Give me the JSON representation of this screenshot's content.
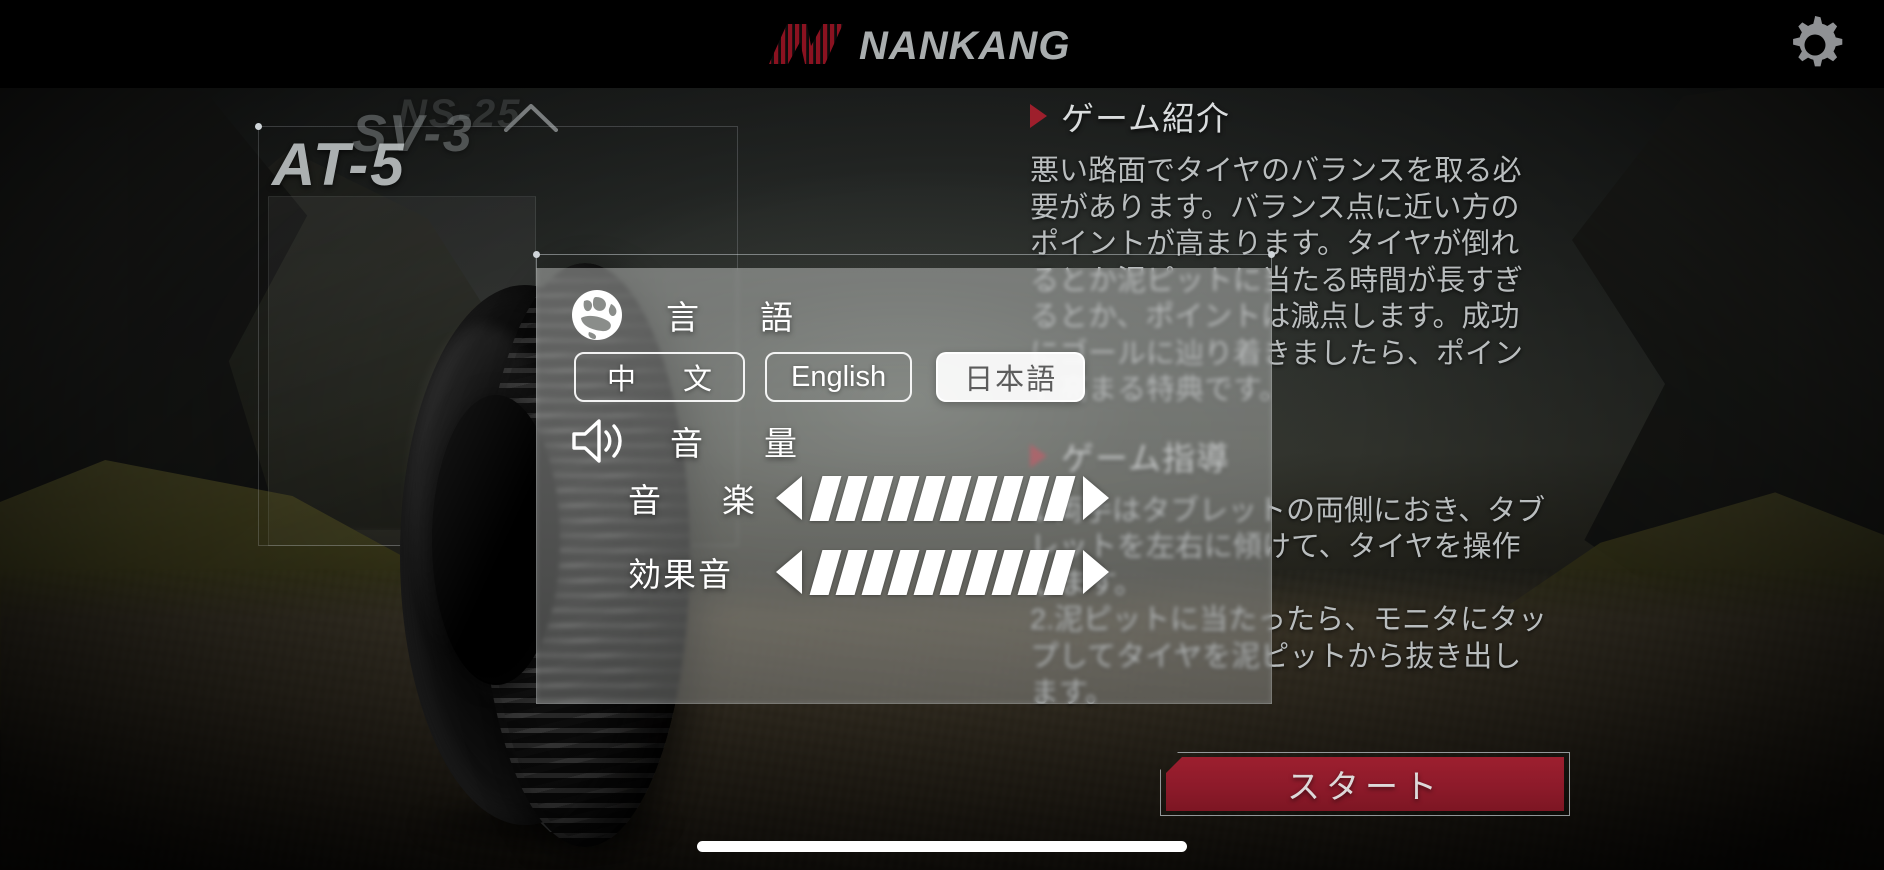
{
  "topbar": {
    "brand_name": "NANKANG",
    "brand_mark_color": "#8a1220",
    "brand_text_color": "#a9adae",
    "settings_icon": "gear-icon"
  },
  "tire_carousel": {
    "active_model": "AT-5",
    "behind_model_1": "SV-3",
    "behind_model_2": "NS-25",
    "up_arrow_icon": "chevron-up-icon",
    "down_arrow_icon": "chevron-down-icon"
  },
  "settings_panel": {
    "language": {
      "icon": "globe-icon",
      "label": "言　語",
      "options": [
        {
          "id": "zh",
          "label": "中　文",
          "selected": false
        },
        {
          "id": "en",
          "label": "English",
          "selected": false
        },
        {
          "id": "ja",
          "label": "日本語",
          "selected": true
        }
      ]
    },
    "volume": {
      "icon": "speaker-icon",
      "label": "音　量",
      "sliders": [
        {
          "id": "music",
          "label": "音　楽",
          "value": 10,
          "max": 10,
          "decrease_icon": "triangle-left-icon",
          "increase_icon": "triangle-right-icon"
        },
        {
          "id": "sfx",
          "label": "効果音",
          "value": 10,
          "max": 10,
          "decrease_icon": "triangle-left-icon",
          "increase_icon": "triangle-right-icon"
        }
      ]
    }
  },
  "info": {
    "intro": {
      "bullet_color": "#9e1f2c",
      "title": "ゲーム紹介",
      "lines": [
        "悪い路面でタイヤのバランスを取る必",
        "要があります。バランス点に近い方の",
        "ポイントが高まります。タイヤが倒れ",
        "るとか泥ピットに当たる時間が長すぎ",
        "るとか、ポイントは減点します。成功",
        "にゴールに辿り着きましたら、ポイン",
        "ト高まる特典です。"
      ]
    },
    "guide": {
      "bullet_color": "#9e1f2c",
      "title": "ゲーム指導",
      "lines": [
        "1.両手はタブレットの両側におき、タブ",
        "レットを左右に傾けて、タイヤを操作",
        "します。",
        "2.泥ピットに当たったら、モニタにタッ",
        "プしてタイヤを泥ピットから抜き出し",
        "ます。"
      ]
    }
  },
  "start_button": {
    "label": "スタート",
    "color": "#8d1a2a"
  }
}
